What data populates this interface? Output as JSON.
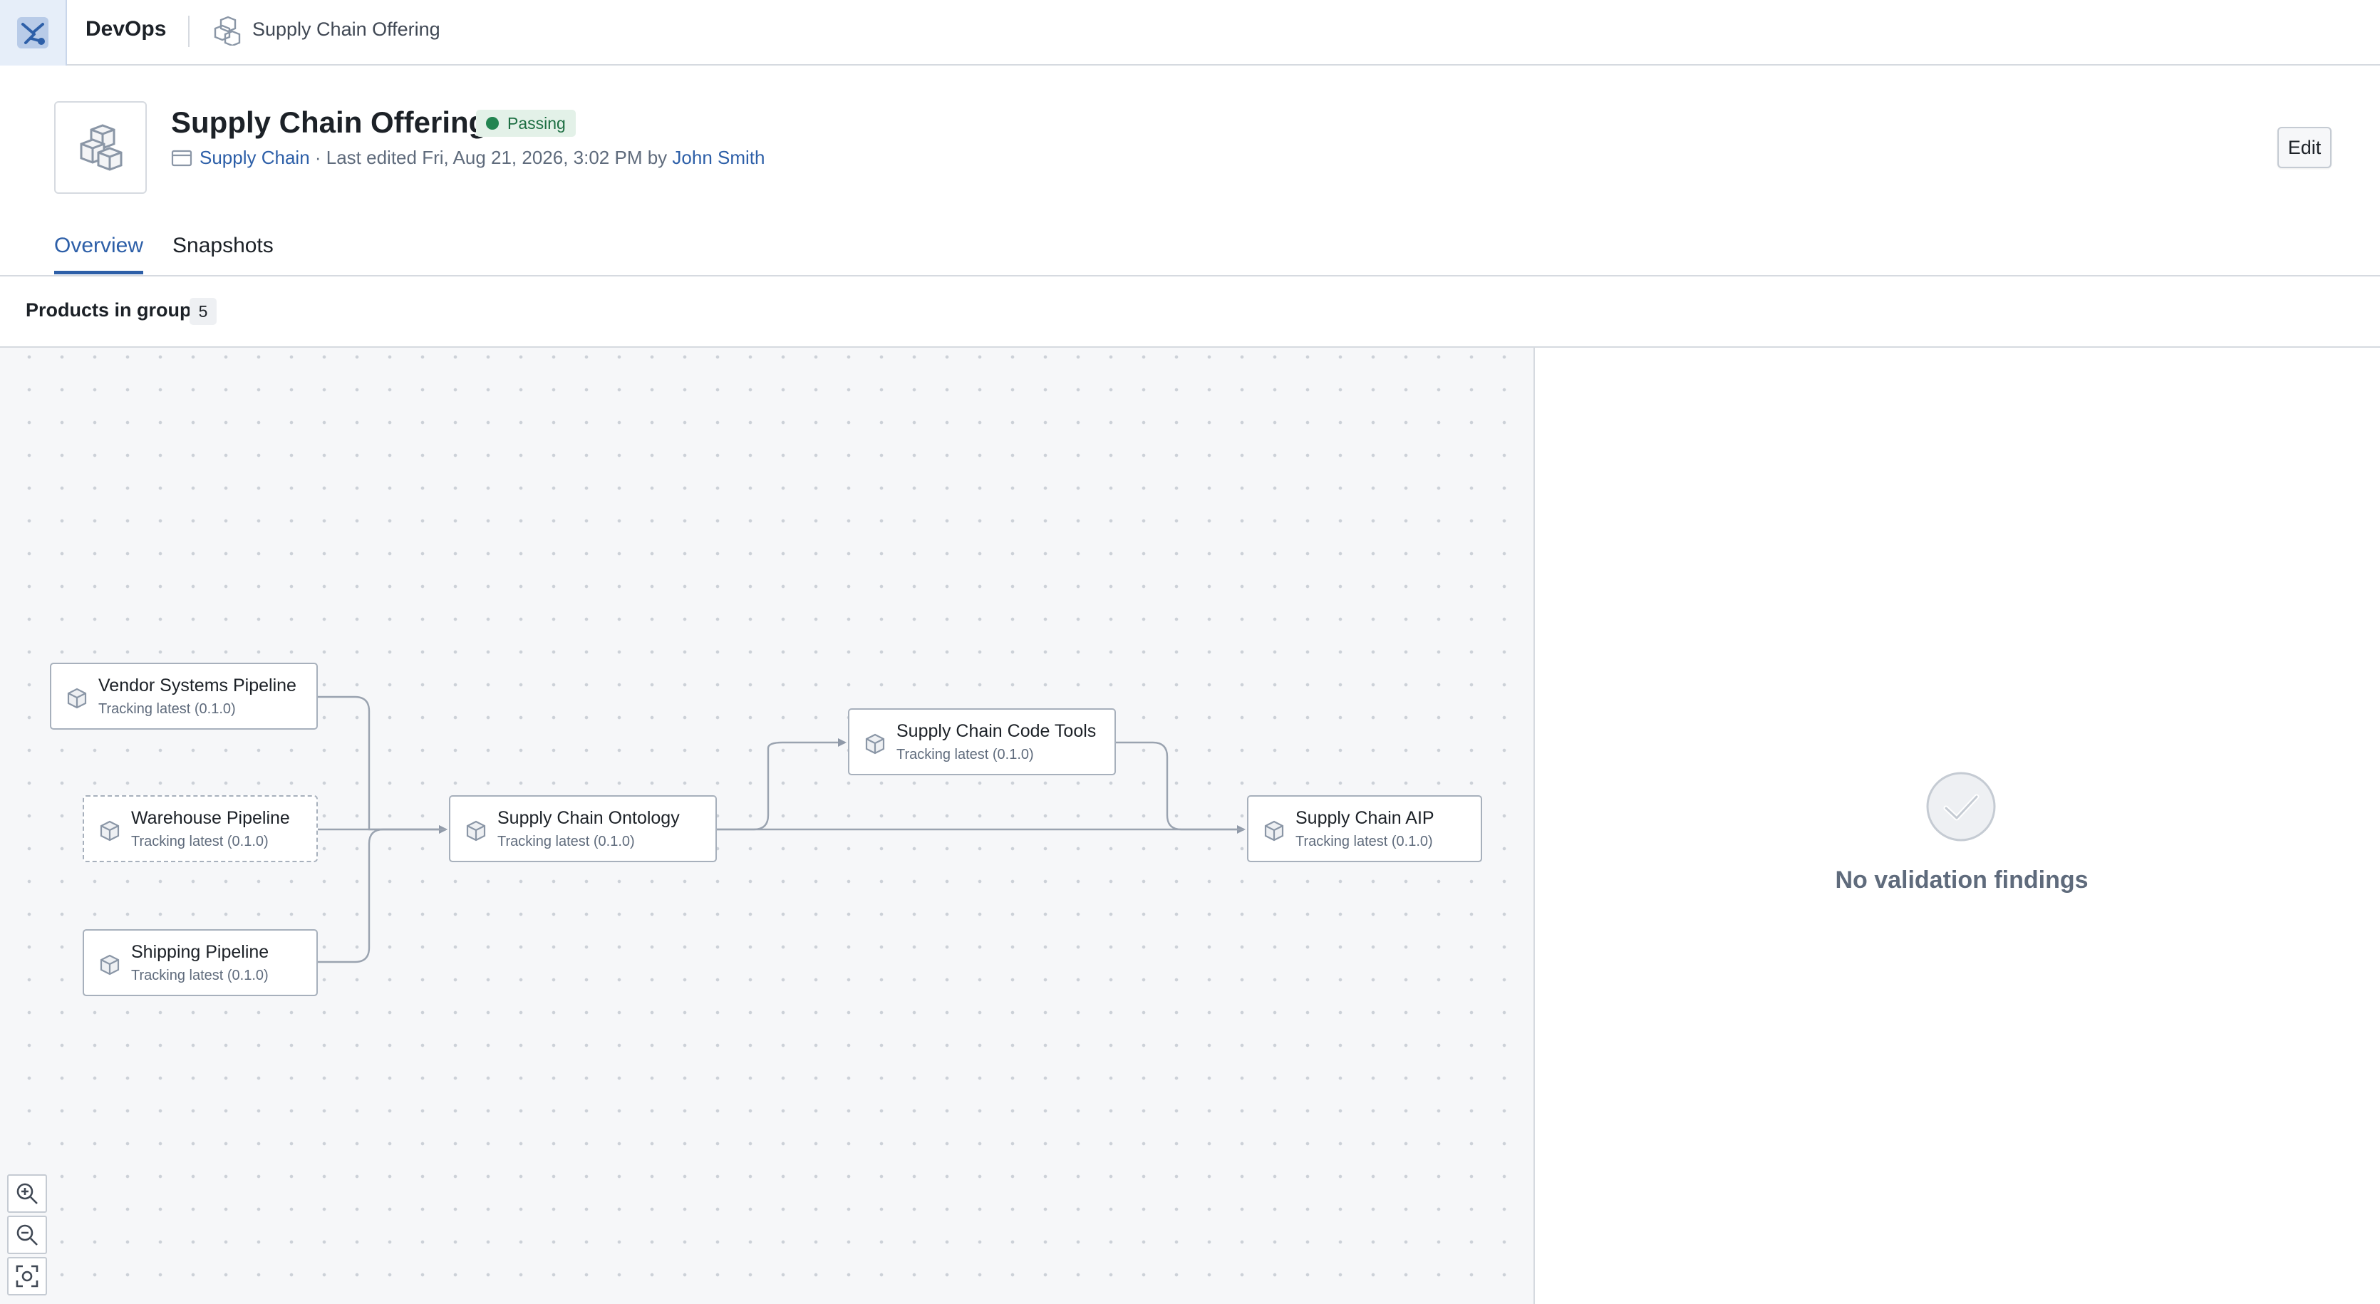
{
  "topbar": {
    "app_name": "DevOps",
    "breadcrumb": "Supply Chain Offering",
    "logo_icon": "devops-tools-icon",
    "breadcrumb_icon": "product-cubes-icon"
  },
  "header": {
    "title": "Supply Chain Offering",
    "status": "Passing",
    "status_color": "#238551",
    "folder_link": "Supply Chain",
    "last_edited": " · Last edited Fri, Aug 21, 2026, 3:02 PM by ",
    "author": "John Smith",
    "edit_label": "Edit"
  },
  "tabs": [
    {
      "label": "Overview",
      "active": true
    },
    {
      "label": "Snapshots",
      "active": false
    }
  ],
  "section": {
    "label": "Products in group",
    "count": "5"
  },
  "graph": {
    "nodes": [
      {
        "id": "vendor",
        "title": "Vendor Systems Pipeline",
        "subtitle": "Tracking latest (0.1.0)",
        "dashed": false
      },
      {
        "id": "warehouse",
        "title": "Warehouse Pipeline",
        "subtitle": "Tracking latest (0.1.0)",
        "dashed": true
      },
      {
        "id": "shipping",
        "title": "Shipping Pipeline",
        "subtitle": "Tracking latest (0.1.0)",
        "dashed": false
      },
      {
        "id": "ontology",
        "title": "Supply Chain Ontology",
        "subtitle": "Tracking latest (0.1.0)",
        "dashed": false
      },
      {
        "id": "codetools",
        "title": "Supply Chain Code Tools",
        "subtitle": "Tracking latest (0.1.0)",
        "dashed": false
      },
      {
        "id": "aip",
        "title": "Supply Chain AIP",
        "subtitle": "Tracking latest (0.1.0)",
        "dashed": false
      }
    ],
    "edges": [
      [
        "vendor",
        "ontology"
      ],
      [
        "warehouse",
        "ontology"
      ],
      [
        "shipping",
        "ontology"
      ],
      [
        "ontology",
        "codetools"
      ],
      [
        "ontology",
        "aip"
      ],
      [
        "codetools",
        "aip"
      ]
    ],
    "zoom_controls": [
      "zoom-in-icon",
      "zoom-out-icon",
      "fit-to-screen-icon"
    ]
  },
  "findings": {
    "message": "No validation findings",
    "icon": "check-circle-icon"
  }
}
